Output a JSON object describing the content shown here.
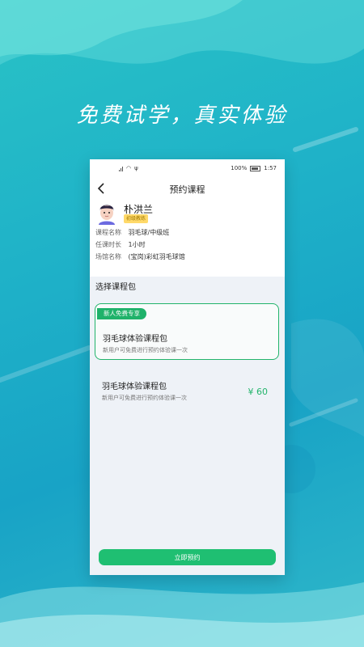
{
  "headline": "免费试学，真实体验",
  "status_bar": {
    "battery_percent": "100%",
    "time": "1:57"
  },
  "nav": {
    "title": "预约课程"
  },
  "coach": {
    "name": "朴洪兰",
    "badge": "初级教练"
  },
  "course_info": [
    {
      "label": "课程名称",
      "value": "羽毛球/中级班"
    },
    {
      "label": "任课时长",
      "value": "1小时"
    },
    {
      "label": "场馆名称",
      "value": "(宝岗)彩虹羽毛球馆"
    }
  ],
  "section_title": "选择课程包",
  "packages": [
    {
      "tag": "新人免费专享",
      "name": "羽毛球体验课程包",
      "desc": "新用户可免费进行预约体验课一次",
      "selected": true
    },
    {
      "name": "羽毛球体验课程包",
      "desc": "新用户可免费进行预约体验课一次",
      "price": "¥ 60",
      "selected": false
    }
  ],
  "book_button": "立即预约",
  "colors": {
    "accent_green": "#1fbf72",
    "background_teal": "#1fb2c8",
    "badge_yellow": "#ffd96a"
  }
}
